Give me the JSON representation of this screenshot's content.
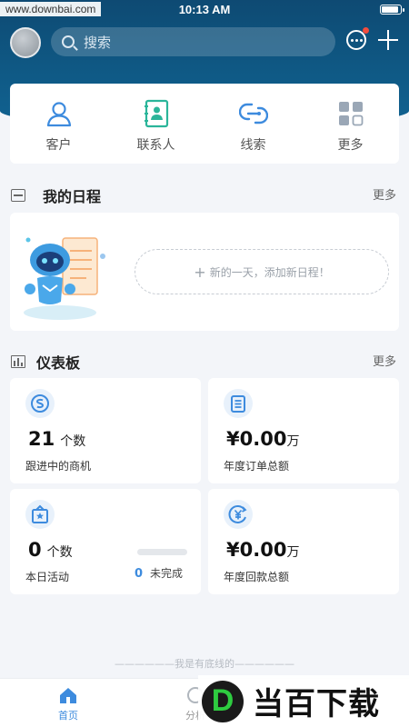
{
  "status_bar": {
    "time": "10:13 AM",
    "watermark": "www.downbai.com"
  },
  "header": {
    "search_placeholder": "搜索"
  },
  "quick_actions": [
    {
      "label": "客户",
      "icon": "customer-icon"
    },
    {
      "label": "联系人",
      "icon": "contact-card-icon"
    },
    {
      "label": "线索",
      "icon": "link-icon"
    },
    {
      "label": "更多",
      "icon": "grid-icon"
    }
  ],
  "schedule": {
    "title": "我的日程",
    "more": "更多",
    "add_text": "新的一天，添加新日程！",
    "add_icon": "+"
  },
  "dashboard": {
    "title": "仪表板",
    "more": "更多",
    "cards": [
      {
        "value": "21",
        "unit": "个数",
        "label": "跟进中的商机",
        "icon": "opportunity-icon"
      },
      {
        "value": "¥0.00",
        "unit": "万",
        "label": "年度订单总额",
        "icon": "order-icon"
      },
      {
        "value": "0",
        "unit": "个数",
        "label": "本日活动",
        "icon": "activity-icon",
        "progress": 0,
        "incomplete_count": "0",
        "incomplete_label": "未完成"
      },
      {
        "value": "¥0.00",
        "unit": "万",
        "label": "年度回款总额",
        "icon": "payment-icon"
      }
    ]
  },
  "bottom_text": "——————我是有底线的——————",
  "tabs": [
    {
      "label": "首页",
      "active": true
    },
    {
      "label": "分析",
      "active": false
    }
  ],
  "watermark_br": {
    "logo_letter": "D",
    "text": "当百下载"
  },
  "colors": {
    "header": "#0f5a86",
    "accent": "#3d8bde",
    "teal": "#2bb59a"
  }
}
